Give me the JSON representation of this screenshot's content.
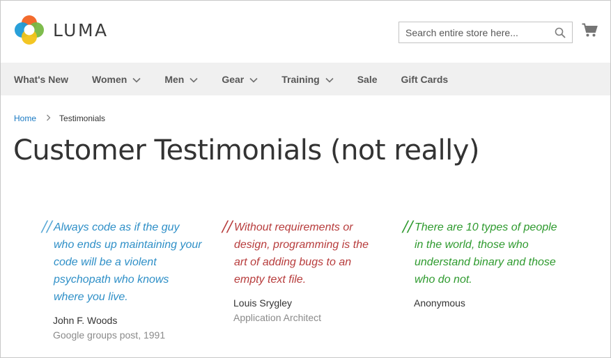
{
  "brand": {
    "name": "LUMA"
  },
  "search": {
    "placeholder": "Search entire store here..."
  },
  "nav": {
    "items": [
      {
        "label": "What's New",
        "dropdown": false
      },
      {
        "label": "Women",
        "dropdown": true
      },
      {
        "label": "Men",
        "dropdown": true
      },
      {
        "label": "Gear",
        "dropdown": true
      },
      {
        "label": "Training",
        "dropdown": true
      },
      {
        "label": "Sale",
        "dropdown": false
      },
      {
        "label": "Gift Cards",
        "dropdown": false
      }
    ]
  },
  "breadcrumb": {
    "home": "Home",
    "current": "Testimonials"
  },
  "page": {
    "title": "Customer Testimonials (not really)"
  },
  "testimonials": [
    {
      "quote": "Always code as if the guy who ends up maintaining your code will be a violent psychopath who knows where you live.",
      "author": "John F. Woods",
      "role": "Google groups post, 1991",
      "color": "#2e8fc7"
    },
    {
      "quote": "Without requirements or design, programming is the art of adding bugs to an empty text file.",
      "author": "Louis Srygley",
      "role": "Application Architect",
      "color": "#b73c3c"
    },
    {
      "quote": "There are 10 types of people in the world, those who understand binary and those who do not.",
      "author": "Anonymous",
      "role": "",
      "color": "#2e9a2e"
    }
  ],
  "icons": {
    "search": "search-icon",
    "cart": "cart-icon",
    "chevron": "chevron-down-icon"
  }
}
